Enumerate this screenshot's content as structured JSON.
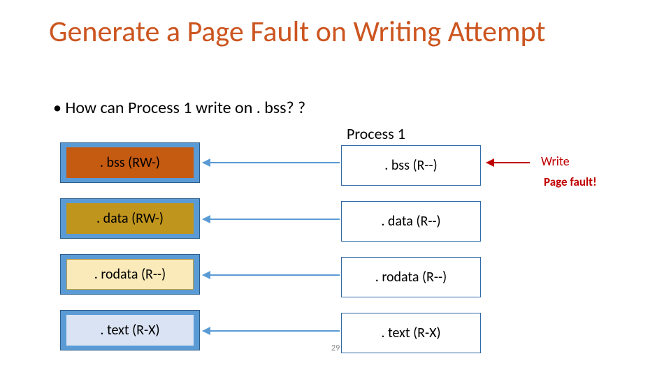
{
  "title": "Generate a Page Fault on Writing Attempt",
  "bullet": "• How can Process 1 write on . bss? ?",
  "process_label": "Process 1",
  "left_segments": [
    {
      "text": ". bss (RW-)",
      "class": "bss"
    },
    {
      "text": ". data (RW-)",
      "class": "data"
    },
    {
      "text": ". rodata (R--)",
      "class": "rodata"
    },
    {
      "text": ". text (R-X)",
      "class": "text"
    }
  ],
  "right_segments": [
    {
      "text": ". bss (R--)"
    },
    {
      "text": ". data (R--)"
    },
    {
      "text": ". rodata (R--)"
    },
    {
      "text": ". text (R-X)"
    }
  ],
  "annotation": {
    "write": "Write",
    "fault": "Page fault!"
  },
  "page_number": "29"
}
